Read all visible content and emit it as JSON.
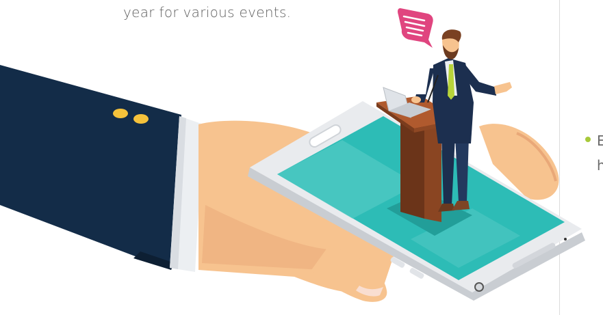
{
  "intro": {
    "text": "year for various events."
  },
  "side": {
    "line1": "E",
    "line2": "h"
  },
  "illustration": {
    "description_icon": "speaker-on-smartphone-illustration",
    "colors": {
      "bullet": "#a7c93a",
      "sleeve": "#132c48",
      "cuff": "#eceff2",
      "skin": "#f7c38f",
      "skin_shadow": "#e9a878",
      "screen": "#2dbcb6",
      "phone_body": "#e9ebee",
      "podium": "#b05a2e",
      "suit": "#1c2f4f",
      "tie": "#b8d43a",
      "bubble": "#e0457f",
      "button": "#f5c23b"
    }
  }
}
